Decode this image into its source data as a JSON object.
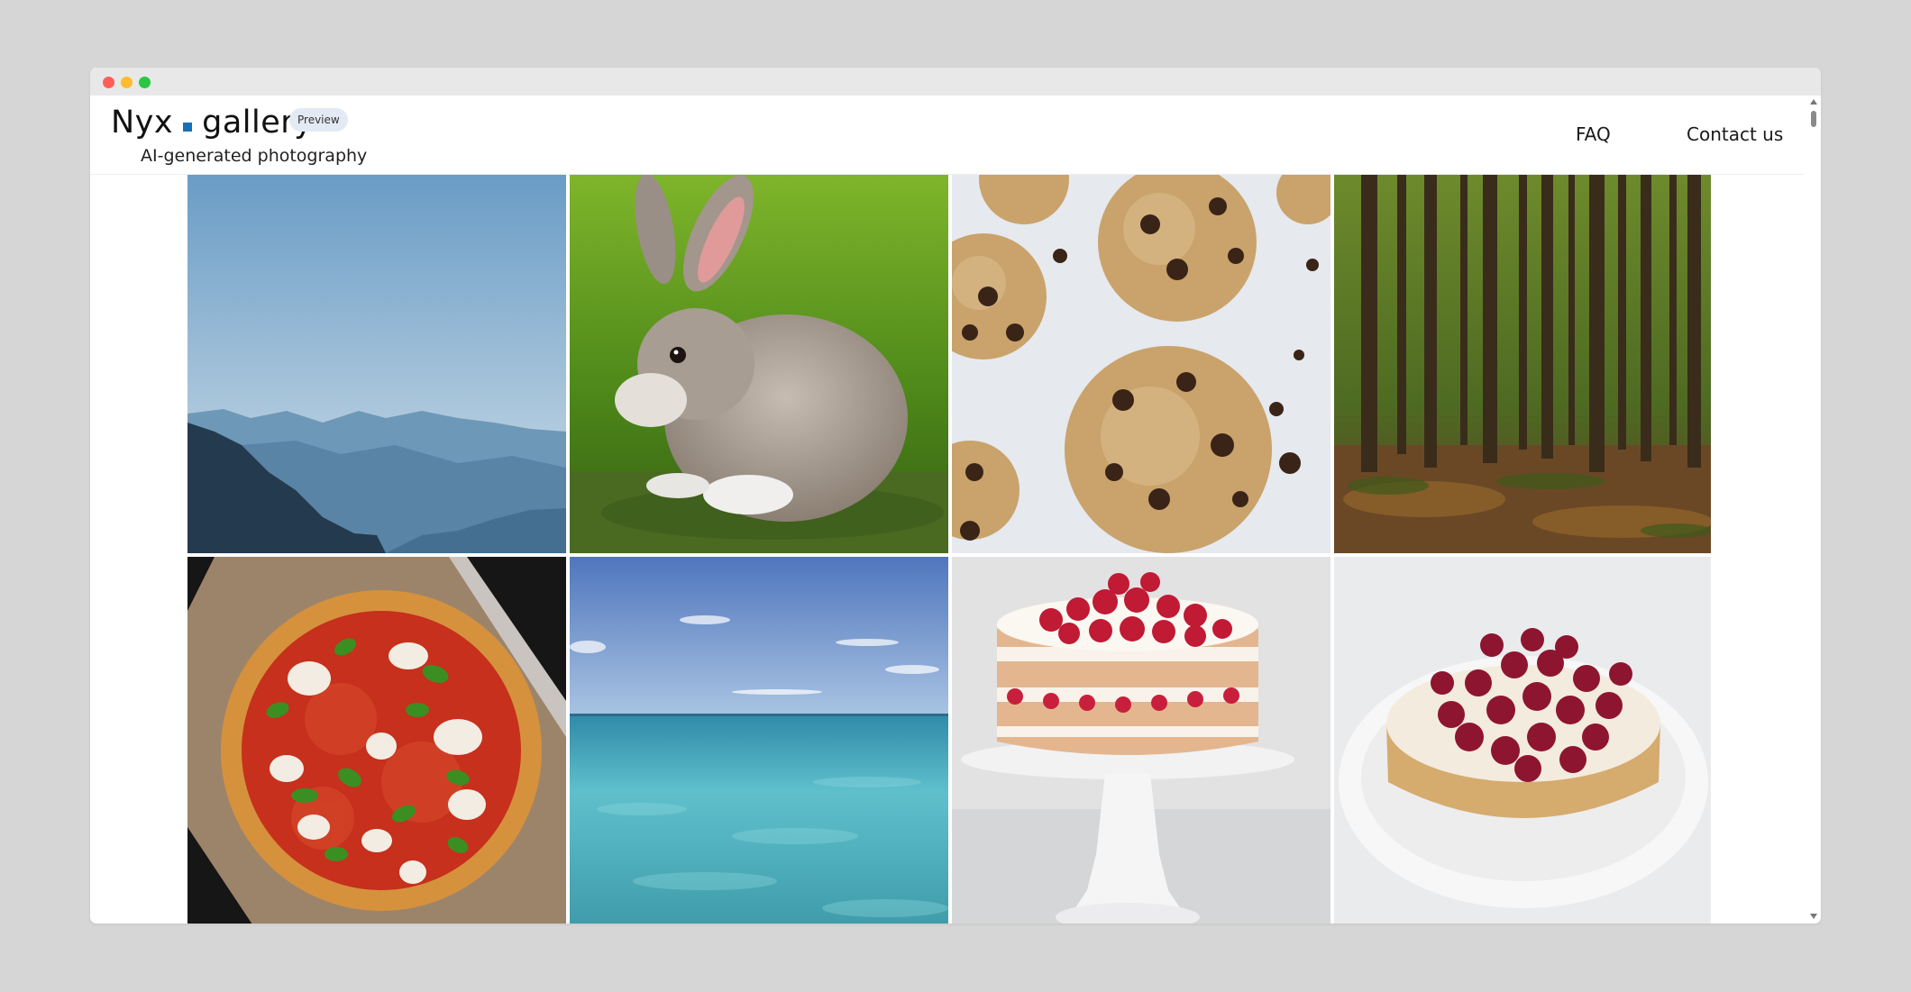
{
  "header": {
    "logo_left": "Nyx",
    "logo_right": "gallery",
    "badge": "Preview",
    "tagline": "AI-generated photography"
  },
  "nav": {
    "faq": "FAQ",
    "contact": "Contact us"
  },
  "colors": {
    "accent": "#1670b8",
    "badge_bg": "#e4eaf3"
  },
  "gallery": [
    {
      "subject": "mountain-haze"
    },
    {
      "subject": "rabbit"
    },
    {
      "subject": "chocolate-chip-cookies"
    },
    {
      "subject": "pine-forest"
    },
    {
      "subject": "margherita-pizza"
    },
    {
      "subject": "ocean"
    },
    {
      "subject": "layered-strawberry-cake"
    },
    {
      "subject": "raspberry-cheesecake"
    }
  ]
}
